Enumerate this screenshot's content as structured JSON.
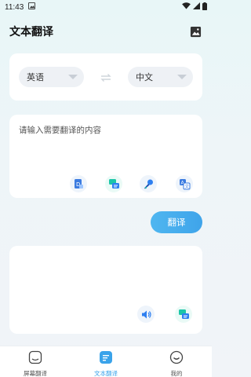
{
  "status": {
    "time": "11:43"
  },
  "header": {
    "title": "文本翻译",
    "image_icon": "image-icon"
  },
  "languages": {
    "from": "英语",
    "to": "中文",
    "swap_icon": "swap-arrows-icon"
  },
  "input": {
    "placeholder": "请输入需要翻译的内容"
  },
  "input_tools": [
    "document-translate-icon",
    "chat-translate-icon",
    "voice-mic-icon",
    "text-translate-icon"
  ],
  "translate_button": {
    "label": "翻译"
  },
  "output_tools": [
    "speaker-icon",
    "chat-translate-icon"
  ],
  "tabs": [
    {
      "label": "屏幕翻译",
      "icon": "screen-icon",
      "active": false
    },
    {
      "label": "文本翻译",
      "icon": "document-icon",
      "active": true
    },
    {
      "label": "我的",
      "icon": "profile-smile-icon",
      "active": false
    }
  ],
  "colors": {
    "accent": "#3aa3ea",
    "accent_light": "#4fb6f0",
    "teal": "#1cc6a8"
  }
}
